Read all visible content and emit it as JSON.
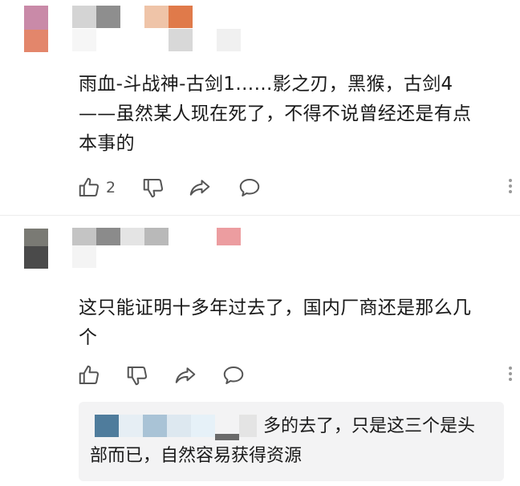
{
  "comments": [
    {
      "text_line1": "雨血-斗战神-古剑1……影之刃，黑猴，古剑4",
      "text_line2": "——虽然某人现在死了，不得不说曾经还是有点",
      "text_line3": "本事的",
      "like_count": "2"
    },
    {
      "text_line1": "这只能证明十多年过去了，国内厂商还是那么几",
      "text_line2": "个",
      "like_count": ""
    }
  ],
  "reply": {
    "text_line1": "多的去了，只是这三个是头",
    "text_line2": "部而已，自然容易获得资源"
  },
  "icons": [
    "thumb-up-icon",
    "thumb-down-icon",
    "share-icon",
    "comment-bubble-icon",
    "more-vertical-icon"
  ],
  "colors": {
    "icon": "#555555",
    "reply_bg": "#f3f3f4",
    "divider": "#ececec"
  }
}
